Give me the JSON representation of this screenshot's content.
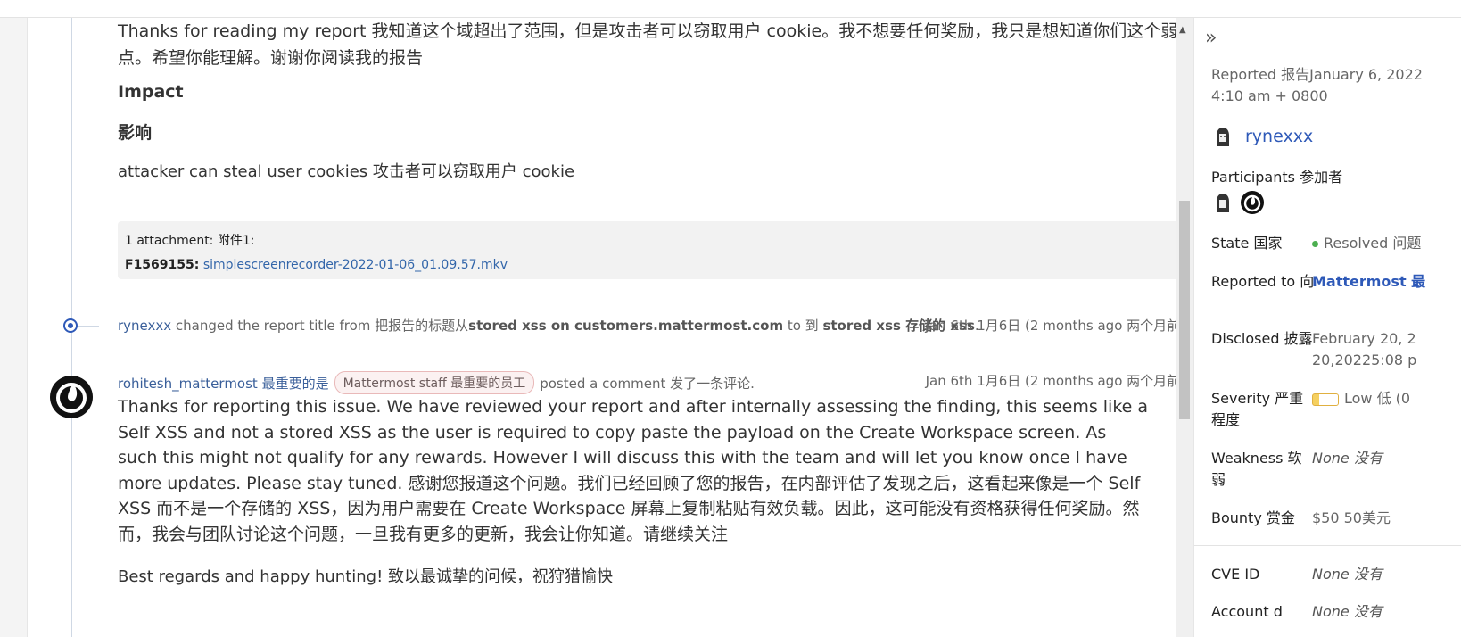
{
  "report": {
    "intro_line1": "Thanks for reading my report 我知道这个域超出了范围，但是攻击者可以窃取用户 cookie。我不想要任何奖励，我只是想知道你们这个弱",
    "intro_line2": "点。希望你能理解。谢谢你阅读我的报告",
    "impact_heading": "Impact",
    "impact_heading_cn": "影响",
    "impact_text": "attacker can steal user cookies 攻击者可以窃取用户 cookie"
  },
  "attachment": {
    "summary": "1 attachment: 附件1:",
    "file_id": "F1569155:",
    "file_name": "simplescreenrecorder-2022-01-06_01.09.57.mkv"
  },
  "title_change": {
    "user": "rynexxx",
    "text_a": " changed the report title from 把报告的标题从",
    "old_title": "stored xss on customers.mattermost.com",
    "text_b": " to 到 ",
    "new_title": "stored xss 存储的 xss",
    "text_c": ".",
    "time": "Jan 6th 1月6日 (2 months ago 两个月前)"
  },
  "comment": {
    "user": "rohitesh_mattermost 最重要的是",
    "badge": "Mattermost staff 最重要的员工",
    "action": "posted a comment 发了一条评论.",
    "time": "Jan 6th 1月6日 (2 months ago 两个月前)",
    "body": "Thanks for reporting this issue. We have reviewed your report and after internally assessing the finding, this seems like a Self XSS and not a stored XSS as the user is required to copy paste the payload on the Create Workspace screen. As such this might not qualify for any rewards. However I will discuss this with the team and will let you know once I have more updates. Please stay tuned. 感谢您报道这个问题。我们已经回顾了您的报告，在内部评估了发现之后，这看起来像是一个 Self XSS 而不是一个存储的 XSS，因为用户需要在 Create Workspace 屏幕上复制粘贴有效负载。因此，这可能没有资格获得任何奖励。然而，我会与团队讨论这个问题，一旦我有更多的更新，我会让你知道。请继续关注",
    "closing": "Best regards and happy hunting! 致以最诚挚的问候，祝狩猎愉快"
  },
  "sidebar": {
    "reported_line1": "Reported 报告January 6, 2022",
    "reported_line2": "4:10 am + 0800",
    "reporter": "rynexxx",
    "participants_label": "Participants 参加者",
    "state_label": "State 国家",
    "state_value": "Resolved 问题",
    "reported_to_label": "Reported to 向",
    "reported_to_value": "Mattermost 最",
    "disclosed_label": "Disclosed 披露",
    "disclosed_line1": "February 20, 2",
    "disclosed_line2": "20,20225:08 p",
    "severity_label_1": "Severity 严重",
    "severity_label_2": "程度",
    "severity_value": "Low 低 (0",
    "weakness_label_1": "Weakness 软",
    "weakness_label_2": "弱",
    "weakness_value": "None 没有",
    "bounty_label": "Bounty 赏金",
    "bounty_value": "$50 50美元",
    "cve_label": "CVE ID",
    "cve_value": "None 没有",
    "account_label": "Account d",
    "account_value": "None 没有"
  }
}
